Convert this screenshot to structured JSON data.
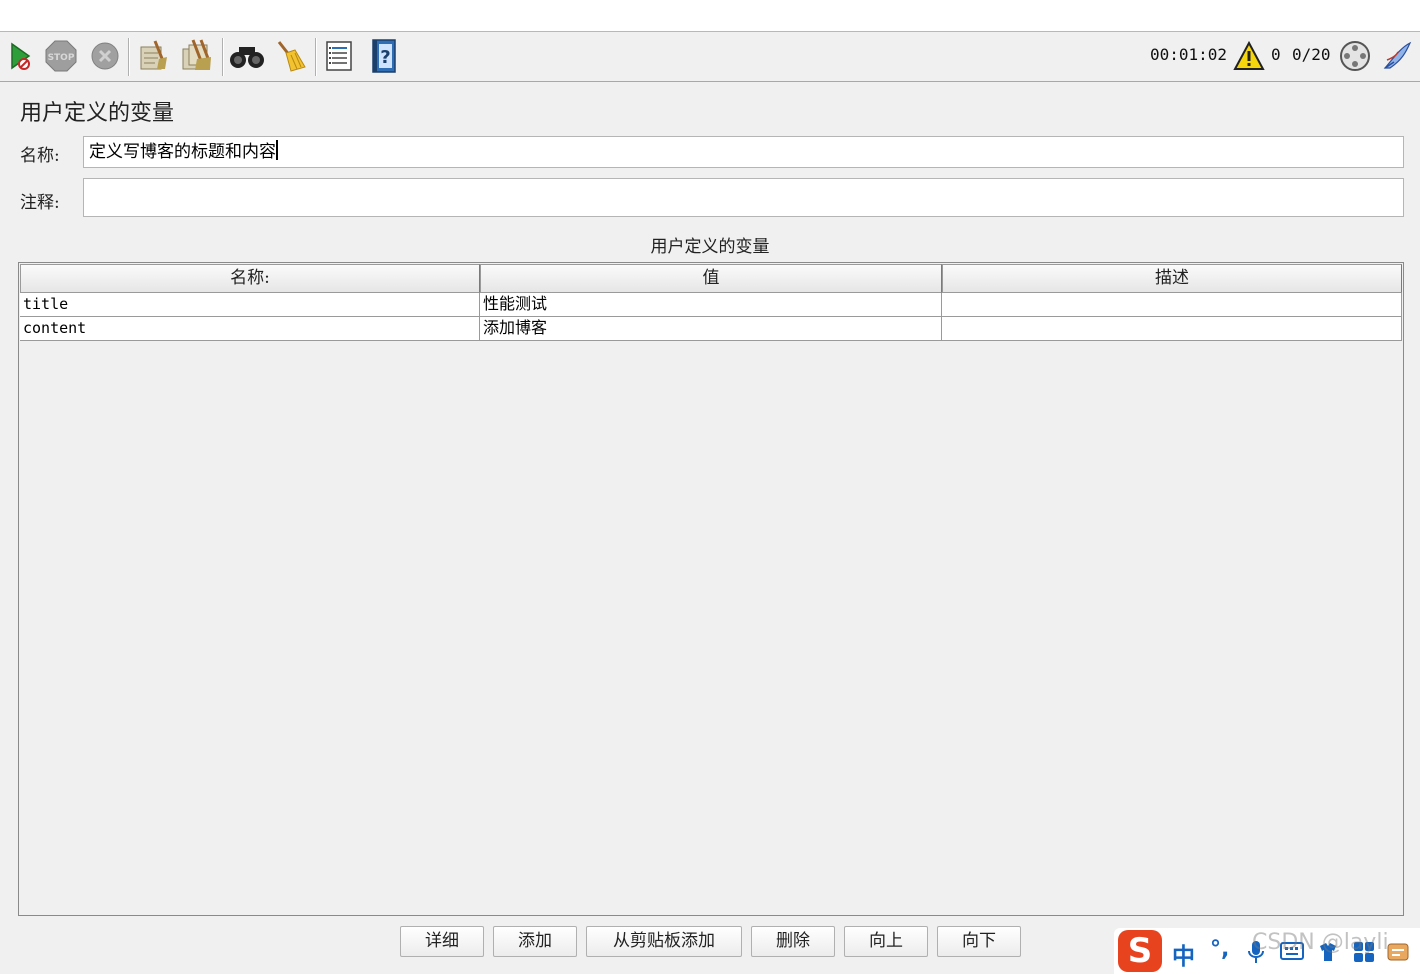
{
  "toolbar": {
    "buttons": [
      {
        "name": "start-icon"
      },
      {
        "name": "stop-icon"
      },
      {
        "name": "shutdown-icon"
      },
      {
        "name": "clear-icon"
      },
      {
        "name": "clear-all-icon"
      },
      {
        "name": "search-icon"
      },
      {
        "name": "reset-search-icon"
      },
      {
        "name": "function-helper-icon"
      },
      {
        "name": "help-icon"
      }
    ],
    "timer": "00:01:02",
    "warning_count": "0",
    "threads": "0/20"
  },
  "panel": {
    "title": "用户定义的变量",
    "name_label": "名称:",
    "name_value": "定义写博客的标题和内容",
    "comment_label": "注释:",
    "comment_value": ""
  },
  "table": {
    "caption": "用户定义的变量",
    "columns": [
      "名称:",
      "值",
      "描述"
    ],
    "rows": [
      {
        "name": "title",
        "value": "性能测试",
        "description": ""
      },
      {
        "name": "content",
        "value": "添加博客",
        "description": ""
      }
    ]
  },
  "buttons": {
    "detail": "详细",
    "add": "添加",
    "add_from_clipboard": "从剪贴板添加",
    "delete": "删除",
    "up": "向上",
    "down": "向下"
  },
  "ime": {
    "logo": "S",
    "lang": "中",
    "punct": "°,"
  },
  "watermark": "CSDN @layli"
}
